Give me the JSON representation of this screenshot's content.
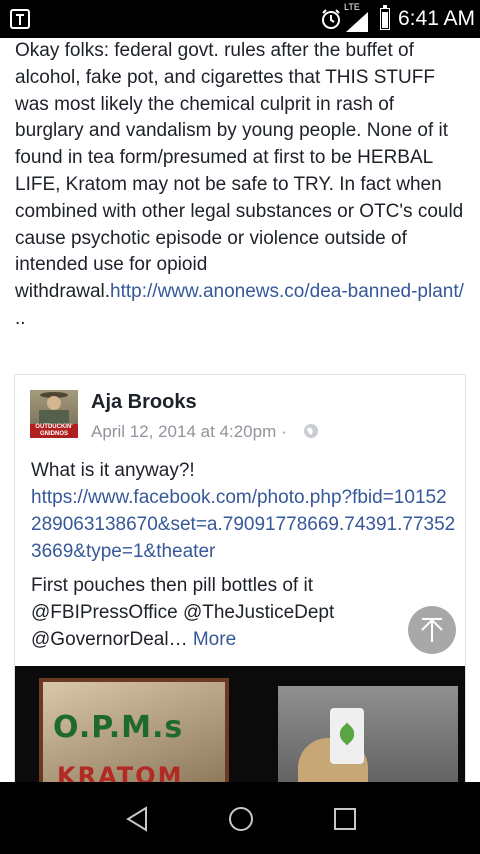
{
  "status_bar": {
    "time": "6:41 AM",
    "network": "LTE",
    "icons": [
      "notification-icon",
      "alarm-icon",
      "signal-icon",
      "battery-icon"
    ]
  },
  "post": {
    "text": "Okay folks: federal govt. rules after the buffet of alcohol, fake pot, and cigarettes that THIS STUFF was most likely the chemical culprit in rash of burglary and vandalism by young people. None of it found in tea form/presumed at first to be HERBAL LIFE, Kratom may not be safe to TRY. In fact when combined with other legal substances or OTC's could cause psychotic episode or violence outside of intended use for opioid withdrawal.",
    "link": "http://www.anonews.co/dea-banned-plant/",
    "trailing": " .."
  },
  "shared_post": {
    "author": "Aja Brooks",
    "avatar_banner": "OUTDUCKIN' GNIDNOS",
    "date": "April 12, 2014 at 4:20pm",
    "separator": "·",
    "text_line": "What is it anyway?!",
    "link": "https://www.facebook.com/photo.php?fbid=10152289063138670&set=a.79091778669.74391.773523669&type=1&theater",
    "text_more": "First pouches then pill bottles of it @FBIPressOffice @TheJusticeDept @GovernorDeal…",
    "more_label": "More",
    "photo_left_line1": "O.P.M.s",
    "photo_left_line2": "KRATOM"
  },
  "colors": {
    "link": "#365899",
    "text": "#1d2129",
    "meta": "#90949c",
    "bars": "#000000"
  },
  "nav": {
    "icons": [
      "back-icon",
      "home-icon",
      "recent-apps-icon"
    ]
  }
}
